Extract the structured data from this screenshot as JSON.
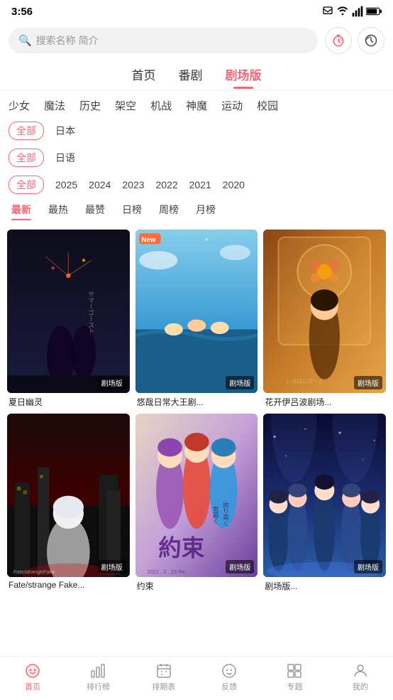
{
  "statusBar": {
    "time": "3:56",
    "icons": [
      "notification",
      "wifi",
      "signal",
      "battery"
    ]
  },
  "search": {
    "placeholder": "搜索名称 简介",
    "searchIconLabel": "🔍",
    "action1Label": "⏱",
    "action2Label": "🕐"
  },
  "mainNav": {
    "tabs": [
      {
        "id": "home",
        "label": "首页",
        "active": false
      },
      {
        "id": "series",
        "label": "番剧",
        "active": false
      },
      {
        "id": "theater",
        "label": "剧场版",
        "active": true
      }
    ]
  },
  "categories": [
    {
      "id": "shoujo",
      "label": "少女"
    },
    {
      "id": "magic",
      "label": "魔法"
    },
    {
      "id": "history",
      "label": "历史"
    },
    {
      "id": "fantasy",
      "label": "架空"
    },
    {
      "id": "mecha",
      "label": "机战"
    },
    {
      "id": "shenmo",
      "label": "神魔"
    },
    {
      "id": "sports",
      "label": "运动"
    },
    {
      "id": "school",
      "label": "校园"
    }
  ],
  "filters": {
    "region": {
      "options": [
        {
          "id": "all",
          "label": "全部",
          "active": true
        },
        {
          "id": "japan",
          "label": "日本",
          "active": false
        }
      ]
    },
    "language": {
      "options": [
        {
          "id": "all",
          "label": "全部",
          "active": true
        },
        {
          "id": "japanese",
          "label": "日语",
          "active": false
        }
      ]
    },
    "year": {
      "options": [
        {
          "id": "all",
          "label": "全部",
          "active": true
        },
        {
          "id": "2025",
          "label": "2025",
          "active": false
        },
        {
          "id": "2024",
          "label": "2024",
          "active": false
        },
        {
          "id": "2023",
          "label": "2023",
          "active": false
        },
        {
          "id": "2022",
          "label": "2022",
          "active": false
        },
        {
          "id": "2021",
          "label": "2021",
          "active": false
        },
        {
          "id": "2020",
          "label": "2020",
          "active": false
        }
      ]
    }
  },
  "sort": {
    "options": [
      {
        "id": "newest",
        "label": "最新",
        "active": true
      },
      {
        "id": "hottest",
        "label": "最热",
        "active": false
      },
      {
        "id": "best",
        "label": "最赞",
        "active": false
      },
      {
        "id": "daily",
        "label": "日榜",
        "active": false
      },
      {
        "id": "weekly",
        "label": "周榜",
        "active": false
      },
      {
        "id": "monthly",
        "label": "月榜",
        "active": false
      }
    ]
  },
  "animeList": [
    {
      "id": 1,
      "title": "夏日幽灵",
      "badge": "剧场版",
      "bgClass": "card-bg-1"
    },
    {
      "id": 2,
      "title": "悠哉日常大王剧...",
      "badge": "剧场版",
      "bgClass": "card-bg-2"
    },
    {
      "id": 3,
      "title": "花开伊吕波剧场...",
      "badge": "剧场版",
      "bgClass": "card-bg-3"
    },
    {
      "id": 4,
      "title": "Fate/strange Fake...",
      "badge": "剧场版",
      "bgClass": "card-bg-4"
    },
    {
      "id": 5,
      "title": "约束",
      "badge": "剧场版",
      "bgClass": "card-bg-5"
    },
    {
      "id": 6,
      "title": "剧场版...",
      "badge": "剧场版",
      "bgClass": "card-bg-6"
    }
  ],
  "bottomNav": {
    "items": [
      {
        "id": "home",
        "label": "首页",
        "active": true,
        "icon": "🎯"
      },
      {
        "id": "ranking",
        "label": "排行榜",
        "active": false,
        "icon": "📊"
      },
      {
        "id": "schedule",
        "label": "排期表",
        "active": false,
        "icon": "📅"
      },
      {
        "id": "feedback",
        "label": "反馈",
        "active": false,
        "icon": "😊"
      },
      {
        "id": "topics",
        "label": "专题",
        "active": false,
        "icon": "📌"
      },
      {
        "id": "mine",
        "label": "我的",
        "active": false,
        "icon": "👤"
      }
    ]
  }
}
